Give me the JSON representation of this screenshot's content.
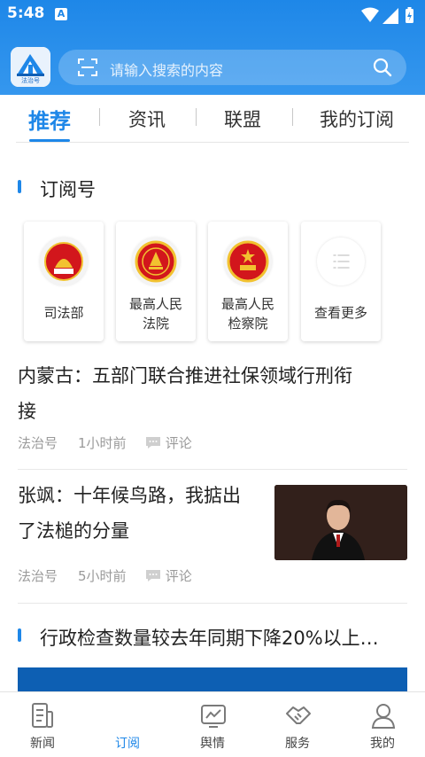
{
  "status_bar": {
    "time": "5:48",
    "notification_letter": "A"
  },
  "app": {
    "logo_text": "法治号",
    "search_placeholder": "请输入搜索的内容"
  },
  "tabs": [
    {
      "label": "推荐",
      "active": true
    },
    {
      "label": "资讯",
      "active": false
    },
    {
      "label": "联盟",
      "active": false
    },
    {
      "label": "我的订阅",
      "active": false
    }
  ],
  "subscription": {
    "section_title": "订阅号",
    "cards": [
      {
        "label": "司法部",
        "icon": "ministry-of-justice-emblem"
      },
      {
        "label_line1": "最高人民",
        "label_line2": "法院",
        "icon": "supreme-court-emblem"
      },
      {
        "label_line1": "最高人民",
        "label_line2": "检察院",
        "icon": "procuratorate-emblem"
      },
      {
        "label": "查看更多",
        "icon": "list-icon"
      }
    ]
  },
  "articles": [
    {
      "title_line1": "内蒙古：五部门联合推进社保领域行刑衔",
      "title_line2": "接",
      "source": "法治号",
      "time": "1小时前",
      "comment_label": "评论"
    },
    {
      "title_line1": "张飒：十年候鸟路，我掂出",
      "title_line2": "了法槌的分量",
      "source": "法治号",
      "time": "5小时前",
      "comment_label": "评论",
      "thumbnail": "judge-portrait"
    }
  ],
  "section3": {
    "title": "行政检查数量较去年同期下降20%以上…"
  },
  "bottom_nav": [
    {
      "label": "新闻",
      "icon": "news-icon",
      "active": false
    },
    {
      "label": "订阅",
      "icon": "subscribe-icon",
      "active": true
    },
    {
      "label": "舆情",
      "icon": "monitor-icon",
      "active": false
    },
    {
      "label": "服务",
      "icon": "handshake-icon",
      "active": false
    },
    {
      "label": "我的",
      "icon": "user-icon",
      "active": false
    }
  ],
  "colors": {
    "primary": "#1e87e8",
    "text": "#222222",
    "muted": "#9a9a9a",
    "emblem_red": "#d2161c",
    "emblem_gold": "#f2c230"
  }
}
